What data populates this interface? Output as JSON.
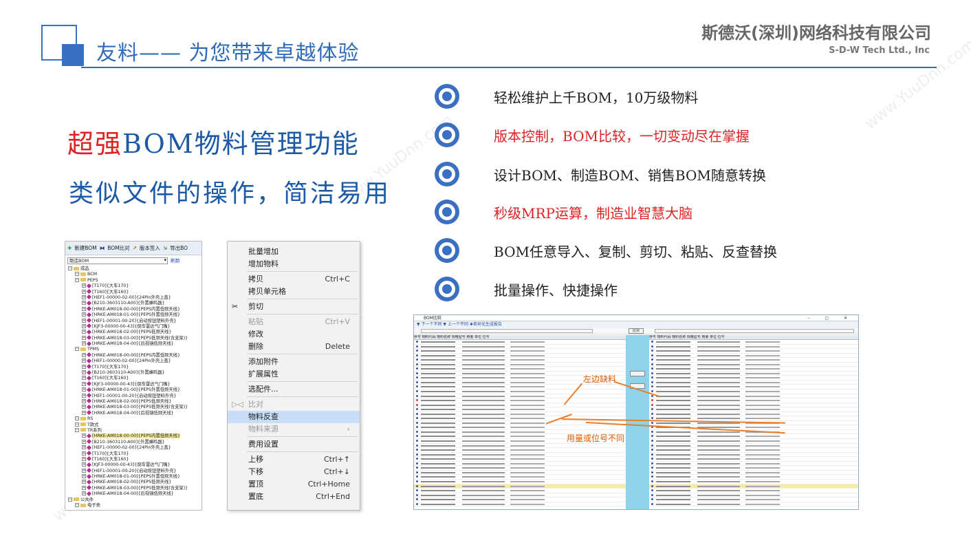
{
  "header": {
    "title": "友料—— 为您带来卓越体验",
    "company_cn": "斯德沃(深圳)网络科技有限公司",
    "company_en": "S-D-W Tech Ltd., Inc"
  },
  "headline": {
    "line1_red": "超强",
    "line1_rest": "BOM物料管理功能",
    "line2": "类似文件的操作，简洁易用"
  },
  "features": [
    {
      "text": "轻松维护上千BOM，10万级物料",
      "color": "#222222"
    },
    {
      "text": "版本控制，BOM比较，一切变动尽在掌握",
      "color": "#dd2222"
    },
    {
      "text": "设计BOM、制造BOM、销售BOM随意转换",
      "color": "#222222"
    },
    {
      "text": "秒级MRP运算，制造业智慧大脑",
      "color": "#dd2222"
    },
    {
      "text": "BOM任意导入、复制、剪切、粘贴、反查替换",
      "color": "#222222"
    },
    {
      "text": "批量操作、快捷操作",
      "color": "#222222"
    }
  ],
  "tree": {
    "toolbar": [
      "新建BOM",
      "BOM比对",
      "版本签入",
      "导出BO"
    ],
    "select_value": "制造BOM",
    "select_link": "刷新",
    "nodes": [
      {
        "level": 0,
        "type": "folder",
        "text": "成品"
      },
      {
        "level": 1,
        "type": "folder",
        "text": "BCM"
      },
      {
        "level": 1,
        "type": "folder",
        "text": "PEPS"
      },
      {
        "level": 2,
        "type": "item",
        "text": "[T170]{大车170}"
      },
      {
        "level": 2,
        "type": "item",
        "text": "[T160]{大车160}"
      },
      {
        "level": 2,
        "type": "item",
        "text": "[HEF1-00000-02-00]{24Pin外壳上盖}"
      },
      {
        "level": 2,
        "type": "item",
        "text": "[B210-3603110-A00]{外置蜂鸣器}"
      },
      {
        "level": 2,
        "type": "item",
        "text": "[HRKE-AM018-00-00]{PEPS内置低频天线}"
      },
      {
        "level": 2,
        "type": "item",
        "text": "[HRKE-AM018-01-00]{PEPS外置低频天线}"
      },
      {
        "level": 2,
        "type": "item",
        "text": "[HEF1-00001-00-20]{启动按钮塑料外壳}"
      },
      {
        "level": 2,
        "type": "item",
        "text": "[KJF3-00000-00-43]{倒车雷达气门嘴}"
      },
      {
        "level": 2,
        "type": "item",
        "text": "[HRKE-AM018-02-00]{PEPS低频天线}"
      },
      {
        "level": 2,
        "type": "item",
        "text": "[HRKE-AM018-03-00]{PEPS低频天线(含支架)}"
      },
      {
        "level": 2,
        "type": "item",
        "text": "[HRKE-AM018-04-00]{后视镜低频天线}"
      },
      {
        "level": 1,
        "type": "folder",
        "text": "TPMS"
      },
      {
        "level": 2,
        "type": "item",
        "text": "[HRKE-AM018-00-00]{PEPS内置低频天线}"
      },
      {
        "level": 2,
        "type": "item",
        "text": "[HEF1-00000-02-00]{24Pin外壳上盖}"
      },
      {
        "level": 2,
        "type": "item",
        "text": "[T170]{大车170}"
      },
      {
        "level": 2,
        "type": "item",
        "text": "[B210-3603110-A00]{外置蜂鸣器}"
      },
      {
        "level": 2,
        "type": "item",
        "text": "[T160]{大车160}"
      },
      {
        "level": 2,
        "type": "item",
        "text": "[KJF3-00000-00-43]{倒车雷达气门嘴}"
      },
      {
        "level": 2,
        "type": "item",
        "text": "[HRKE-AM018-01-00]{PEPS外置低频天线}"
      },
      {
        "level": 2,
        "type": "item",
        "text": "[HEF1-00001-00-20]{启动按钮塑料外壳}"
      },
      {
        "level": 2,
        "type": "item",
        "text": "[HRKE-AM018-02-00]{PEPS低频天线}"
      },
      {
        "level": 2,
        "type": "item",
        "text": "[HRKE-AM018-03-00]{PEPS低频天线(含支架)}"
      },
      {
        "level": 2,
        "type": "item",
        "text": "[HRKE-AM018-04-00]{后视镜低频天线}"
      },
      {
        "level": 1,
        "type": "folder",
        "text": "RS"
      },
      {
        "level": 1,
        "type": "folder",
        "text": "T款式"
      },
      {
        "level": 1,
        "type": "folder",
        "text": "TR系列"
      },
      {
        "level": 2,
        "type": "item",
        "text": "[HRKE-AM018-00-00]{PEPS内置低频天线}",
        "highlight": true
      },
      {
        "level": 2,
        "type": "item",
        "text": "[B210-3603110-A00]{外置蜂鸣器}"
      },
      {
        "level": 2,
        "type": "item",
        "text": "[HEF1-00000-02-00]{24Pin外壳上盖}"
      },
      {
        "level": 2,
        "type": "item",
        "text": "[T170]{大车170}"
      },
      {
        "level": 2,
        "type": "item",
        "text": "[T160]{大车160}"
      },
      {
        "level": 2,
        "type": "item",
        "text": "[KJF3-00000-00-43]{倒车雷达气门嘴}"
      },
      {
        "level": 2,
        "type": "item",
        "text": "[HEF1-00001-00-20]{启动按钮塑料外壳}"
      },
      {
        "level": 2,
        "type": "item",
        "text": "[HRKE-AM018-01-00]{PEPS外置低频天线}"
      },
      {
        "level": 2,
        "type": "item",
        "text": "[HRKE-AM018-02-00]{PEPS低频天线}"
      },
      {
        "level": 2,
        "type": "item",
        "text": "[HRKE-AM018-03-00]{PEPS低频天线(含支架)}"
      },
      {
        "level": 2,
        "type": "item",
        "text": "[HRKE-AM018-04-00]{后视镜低频天线}"
      },
      {
        "level": 0,
        "type": "folder",
        "text": "公共件"
      },
      {
        "level": 1,
        "type": "folder",
        "text": "电子类"
      }
    ]
  },
  "context_menu": {
    "items": [
      {
        "label": "批量增加",
        "shortcut": "",
        "disabled": false
      },
      {
        "label": "增加物料",
        "shortcut": "",
        "disabled": false
      },
      {
        "sep": true
      },
      {
        "label": "拷贝",
        "shortcut": "Ctrl+C",
        "disabled": false
      },
      {
        "label": "拷贝单元格",
        "shortcut": "",
        "disabled": false
      },
      {
        "sep": true
      },
      {
        "label": "剪切",
        "shortcut": "",
        "disabled": false,
        "icon": "✂"
      },
      {
        "sep": true
      },
      {
        "label": "粘贴",
        "shortcut": "Ctrl+V",
        "disabled": true
      },
      {
        "label": "修改",
        "shortcut": "",
        "disabled": false
      },
      {
        "label": "删除",
        "shortcut": "Delete",
        "disabled": false
      },
      {
        "sep": true
      },
      {
        "label": "添加附件",
        "shortcut": "",
        "disabled": false
      },
      {
        "label": "扩展属性",
        "shortcut": "",
        "disabled": false
      },
      {
        "sep": true
      },
      {
        "label": "选配件...",
        "shortcut": "",
        "disabled": false
      },
      {
        "sep": true
      },
      {
        "label": "比对",
        "shortcut": "",
        "disabled": true,
        "icon": "▷◁"
      },
      {
        "label": "物料反查",
        "shortcut": "",
        "disabled": false,
        "selected": true
      },
      {
        "label": "物料来源",
        "shortcut": "›",
        "disabled": true
      },
      {
        "sep": true
      },
      {
        "label": "费用设置",
        "shortcut": "",
        "disabled": false
      },
      {
        "sep": true
      },
      {
        "label": "上移",
        "shortcut": "Ctrl+↑",
        "disabled": false
      },
      {
        "label": "下移",
        "shortcut": "Ctrl+↓",
        "disabled": false
      },
      {
        "label": "置顶",
        "shortcut": "Ctrl+Home",
        "disabled": false
      },
      {
        "label": "置底",
        "shortcut": "Ctrl+End",
        "disabled": false
      }
    ]
  },
  "compare_window": {
    "title": "BOM比较",
    "toolbar": "▼ 下一个不同    ▼ 上一个不同    ✱差异化生成报告",
    "compare_btn": "比对",
    "columns": "序号  物料代码    物料名称        规格型号       用量  单位  位号",
    "annotation_missing": "左边缺料",
    "annotation_diff": "用量或位号不同"
  },
  "watermark": "www.YuuDnn.com"
}
